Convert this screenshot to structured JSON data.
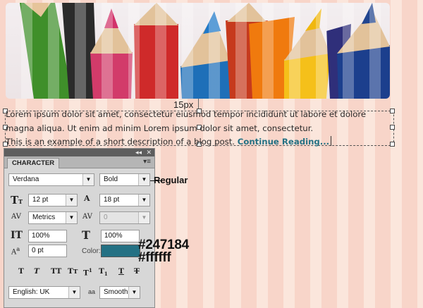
{
  "annotations": {
    "spacing": "15px",
    "font_style_note": "Regular",
    "color_primary": "#247184",
    "color_secondary": "#ffffff"
  },
  "paragraph": {
    "line1": "Lorem ipsum dolor sit amet, consectetur eiusmod tempor incididunt ut labore et dolore",
    "line2": "magna aliqua. Ut enim ad minim Lorem ipsum dolor sit amet, consectetur.",
    "line3": "This is an example of a short description of a blog post.",
    "link": "Continue Reading..."
  },
  "panel": {
    "title": "CHARACTER",
    "font_family": "Verdana",
    "font_style": "Bold",
    "font_size": "12 pt",
    "leading": "18 pt",
    "kerning": "Metrics",
    "tracking": "0",
    "vertical_scale": "100%",
    "horizontal_scale": "100%",
    "baseline_shift": "0 pt",
    "color_label": "Color:",
    "language": "English: UK",
    "antialias": "Smooth",
    "antialias_icon": "aa"
  },
  "colors": {
    "text_color": "#247184",
    "link_color": "#247184",
    "stripe_dark": "#f8d5c9",
    "stripe_light": "#fbe6dc"
  },
  "icons": [
    "font-size-icon",
    "leading-icon",
    "kerning-icon",
    "tracking-icon",
    "vertical-scale-icon",
    "horizontal-scale-icon",
    "baseline-shift-icon"
  ]
}
